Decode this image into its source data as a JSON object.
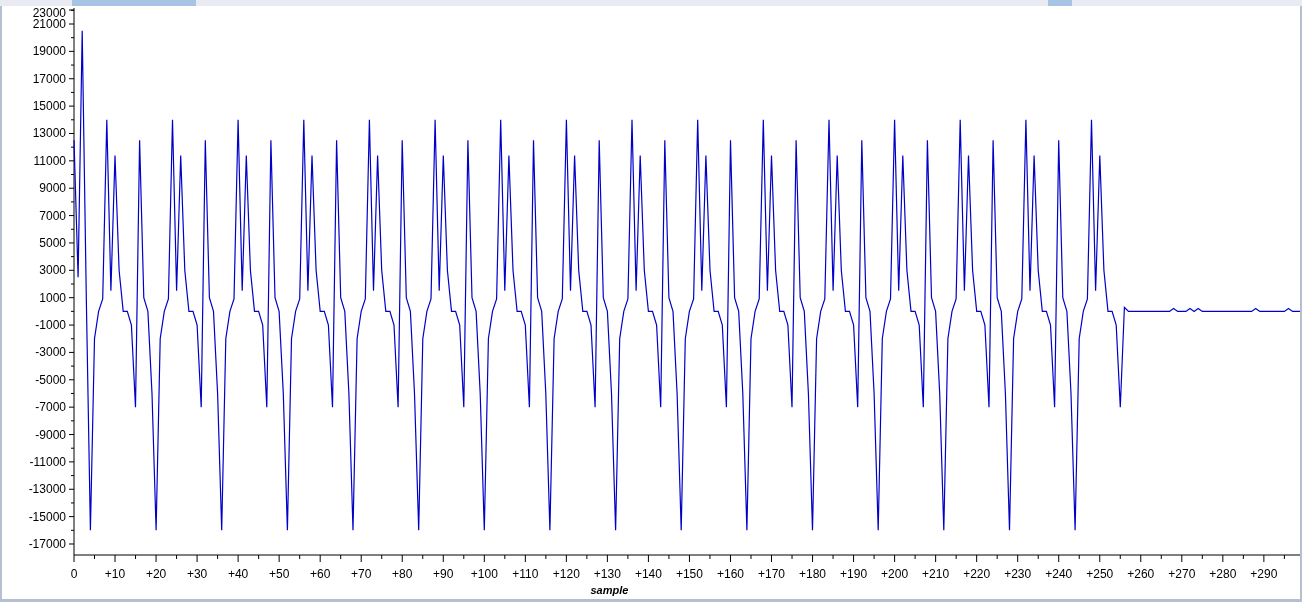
{
  "chart": {
    "ytick_labels": [
      "23000",
      "21000",
      "19000",
      "17000",
      "15000",
      "13000",
      "11000",
      "9000",
      "7000",
      "5000",
      "3000",
      "1000",
      "-1000",
      "-3000",
      "-5000",
      "-7000",
      "-9000",
      "-11000",
      "-13000",
      "-15000",
      "-17000"
    ],
    "xtick_labels": [
      "0",
      "+10",
      "+20",
      "+30",
      "+40",
      "+50",
      "+60",
      "+70",
      "+80",
      "+90",
      "+100",
      "+110",
      "+120",
      "+130",
      "+140",
      "+150",
      "+160",
      "+170",
      "+180",
      "+190",
      "+200",
      "+210",
      "+220",
      "+230",
      "+240",
      "+250",
      "+260",
      "+270",
      "+280",
      "+290"
    ],
    "xlabel": "sample"
  }
}
